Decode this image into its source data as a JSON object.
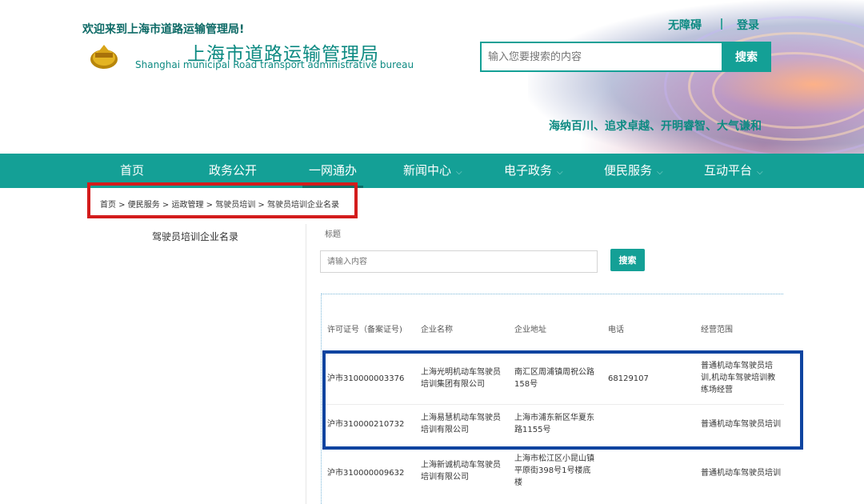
{
  "header": {
    "welcome": "欢迎来到上海市道路运输管理局!",
    "accessibility": "无障碍",
    "login": "登录",
    "title_cn": "上海市道路运输管理局",
    "title_en": "Shanghai municipal Road transport administrative bureau",
    "search_placeholder": "输入您要搜索的内容",
    "search_button": "搜索",
    "slogan": "海纳百川、追求卓越、开明睿智、大气谦和"
  },
  "nav": {
    "items": [
      {
        "label": "首页",
        "has_dropdown": false
      },
      {
        "label": "政务公开",
        "has_dropdown": false
      },
      {
        "label": "一网通办",
        "has_dropdown": false,
        "active": true
      },
      {
        "label": "新闻中心",
        "has_dropdown": true
      },
      {
        "label": "电子政务",
        "has_dropdown": true
      },
      {
        "label": "便民服务",
        "has_dropdown": true
      },
      {
        "label": "互动平台",
        "has_dropdown": true
      }
    ],
    "chevron": "⌵"
  },
  "breadcrumb": {
    "text": "首页 > 便民服务 > 运政管理 > 驾驶员培训 > 驾驶员培训企业名录"
  },
  "sidebar": {
    "title": "驾驶员培训企业名录"
  },
  "filter": {
    "label": "标题",
    "placeholder": "请输入内容",
    "button": "搜索"
  },
  "table": {
    "headers": [
      "许可证号（备案证号)",
      "企业名称",
      "企业地址",
      "电话",
      "经营范围"
    ],
    "rows": [
      {
        "license": "沪市310000003376",
        "name": [
          "上海光明机动车驾驶员",
          "培训集团有限公司"
        ],
        "address": [
          "南汇区周浦镇周祝公路",
          "158号"
        ],
        "phone": "68129107",
        "scope": [
          "普通机动车驾驶员培",
          "训,机动车驾驶培训教",
          "练场经营"
        ]
      },
      {
        "license": "沪市310000210732",
        "name": [
          "上海易慧机动车驾驶员",
          "培训有限公司"
        ],
        "address": [
          "上海市浦东新区华夏东",
          "路1155号"
        ],
        "phone": "",
        "scope": [
          "普通机动车驾驶员培训"
        ]
      },
      {
        "license": "沪市310000009632",
        "name": [
          "上海新诚机动车驾驶员",
          "培训有限公司"
        ],
        "address": [
          "上海市松江区小昆山镇",
          "平原街398号1号楼底",
          "楼"
        ],
        "phone": "",
        "scope": [
          "普通机动车驾驶员培训"
        ]
      }
    ]
  },
  "colors": {
    "brand_teal": "#14a096",
    "highlight_red": "#d31c1c",
    "highlight_blue": "#0e44a0"
  }
}
